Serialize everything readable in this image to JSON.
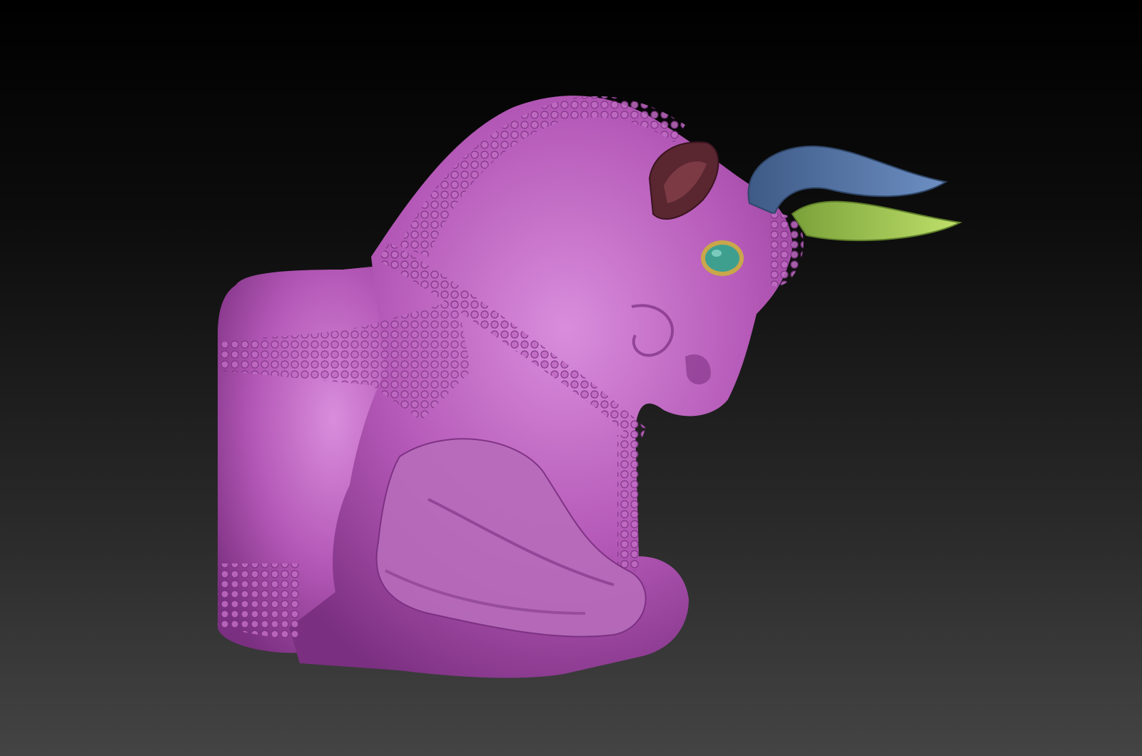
{
  "scene": {
    "subject": "bull-sculpture",
    "colors": {
      "background_top": "#000000",
      "background_bottom": "#444444",
      "body": "#b357b6",
      "body_shadow": "#7a2f80",
      "body_highlight": "#d98ddc",
      "ear": "#5a2630",
      "horn_front": "#5776a6",
      "horn_back": "#9cc34b",
      "eye": "#3f9f8f",
      "eye_ring": "#c9a74a"
    }
  }
}
